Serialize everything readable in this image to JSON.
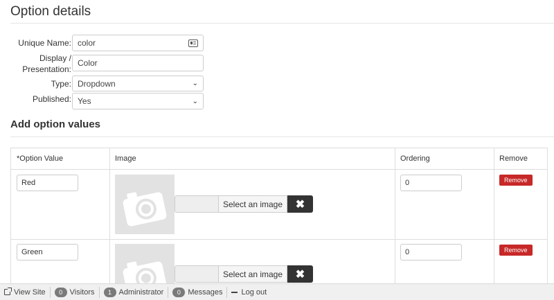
{
  "page": {
    "title": "Option details"
  },
  "form": {
    "unique_name": {
      "label": "Unique Name:",
      "value": "color"
    },
    "display": {
      "label_line1": "Display /",
      "label_line2": "Presentation:",
      "value": "Color"
    },
    "type": {
      "label": "Type:",
      "value": "Dropdown"
    },
    "published": {
      "label": "Published:",
      "value": "Yes"
    }
  },
  "values_section": {
    "title": "Add option values",
    "columns": [
      "*Option Value",
      "Image",
      "Ordering",
      "Remove"
    ],
    "rows": [
      {
        "value": "Red",
        "select_image_label": "Select an image",
        "ordering": "0",
        "remove_label": "Remove"
      },
      {
        "value": "Green",
        "select_image_label": "Select an image",
        "ordering": "0",
        "remove_label": "Remove"
      }
    ]
  },
  "statusbar": {
    "view_site": "View Site",
    "visitors_count": "0",
    "visitors_label": "Visitors",
    "admin_count": "1",
    "admin_label": "Administrator",
    "messages_count": "0",
    "messages_label": "Messages",
    "logout": "Log out"
  },
  "icons": {
    "unique_name_field": "id-card-icon",
    "select_chevron": "chevron-down-icon",
    "image_placeholder": "camera-icon",
    "clear_image": "close-icon",
    "view_site": "external-link-icon",
    "logout": "minus-icon"
  },
  "colors": {
    "remove_button": "#c72828",
    "clear_button": "#333333",
    "badge": "#7a7a7a"
  }
}
